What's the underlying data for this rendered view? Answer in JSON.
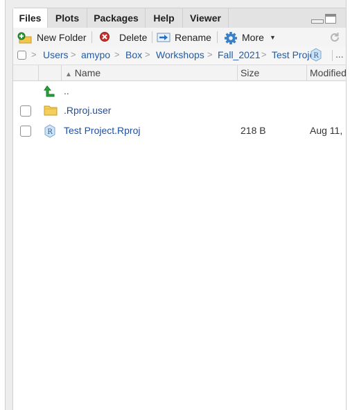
{
  "tabs": [
    {
      "label": "Files",
      "active": true
    },
    {
      "label": "Plots",
      "active": false
    },
    {
      "label": "Packages",
      "active": false
    },
    {
      "label": "Help",
      "active": false
    },
    {
      "label": "Viewer",
      "active": false
    }
  ],
  "toolbar": {
    "new_folder": "New Folder",
    "delete": "Delete",
    "rename": "Rename",
    "more": "More"
  },
  "breadcrumb": {
    "items": [
      "Users",
      "amypo",
      "Box",
      "Workshops",
      "Fall_2021",
      "Test Proje"
    ],
    "overflow": "..."
  },
  "columns": {
    "name": "Name",
    "size": "Size",
    "modified": "Modified"
  },
  "files": [
    {
      "name": "..",
      "size": "",
      "modified": "",
      "icon": "parent-directory-icon"
    },
    {
      "name": ".Rproj.user",
      "size": "",
      "modified": "",
      "icon": "folder-icon"
    },
    {
      "name": "Test Project.Rproj",
      "size": "218 B",
      "modified": "Aug 11,",
      "icon": "rproj-file-icon"
    }
  ]
}
